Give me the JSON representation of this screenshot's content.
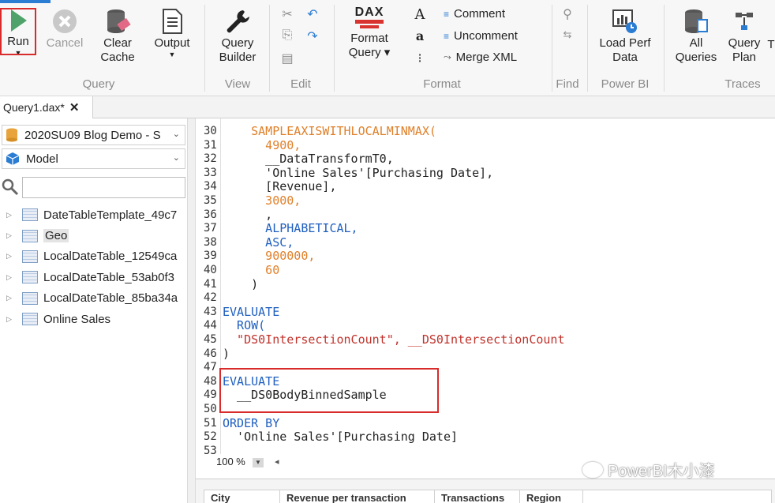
{
  "ribbon": {
    "groups": {
      "query": "Query",
      "view": "View",
      "edit": "Edit",
      "format": "Format",
      "find": "Find",
      "powerbi": "Power BI",
      "traces": "Traces"
    },
    "buttons": {
      "run": "Run",
      "cancel": "Cancel",
      "clear_cache": [
        "Clear",
        "Cache"
      ],
      "output": "Output",
      "query_builder": [
        "Query",
        "Builder"
      ],
      "format_query": [
        "Format",
        "Query ▾"
      ],
      "dax_logo": "DAX",
      "comment": "Comment",
      "uncomment": "Uncomment",
      "merge_xml": "Merge XML",
      "load_perf_data": [
        "Load Perf",
        "Data"
      ],
      "all_queries": [
        "All",
        "Queries"
      ],
      "query_plan": [
        "Query",
        "Plan"
      ],
      "overflow": "T"
    }
  },
  "tabs": {
    "active": "Query1.dax*"
  },
  "left_panel": {
    "connection": "2020SU09 Blog Demo - S",
    "model": "Model",
    "search_value": "",
    "tables": [
      {
        "label": "DateTableTemplate_49c7"
      },
      {
        "label": "Geo"
      },
      {
        "label": "LocalDateTable_12549ca"
      },
      {
        "label": "LocalDateTable_53ab0f3"
      },
      {
        "label": "LocalDateTable_85ba34a"
      },
      {
        "label": "Online Sales"
      }
    ]
  },
  "editor": {
    "lines": [
      {
        "n": "30",
        "t": "    SAMPLEAXISWITHLOCALMINMAX("
      },
      {
        "n": "31",
        "t": "      4900,"
      },
      {
        "n": "32",
        "t": "      __DataTransformT0,"
      },
      {
        "n": "33",
        "t": "      'Online Sales'[Purchasing Date],"
      },
      {
        "n": "34",
        "t": "      [Revenue],"
      },
      {
        "n": "35",
        "t": "      3000,"
      },
      {
        "n": "36",
        "t": "      ,"
      },
      {
        "n": "37",
        "t": "      ALPHABETICAL,"
      },
      {
        "n": "38",
        "t": "      ASC,"
      },
      {
        "n": "39",
        "t": "      900000,"
      },
      {
        "n": "40",
        "t": "      60"
      },
      {
        "n": "41",
        "t": "    )"
      },
      {
        "n": "42",
        "t": ""
      },
      {
        "n": "43",
        "t": "EVALUATE"
      },
      {
        "n": "44",
        "t": "  ROW("
      },
      {
        "n": "45",
        "t": "  \"DS0IntersectionCount\", __DS0IntersectionCount"
      },
      {
        "n": "46",
        "t": ")"
      },
      {
        "n": "47",
        "t": ""
      },
      {
        "n": "48",
        "t": "EVALUATE"
      },
      {
        "n": "49",
        "t": "  __DS0BodyBinnedSample"
      },
      {
        "n": "50",
        "t": ""
      },
      {
        "n": "51",
        "t": "ORDER BY"
      },
      {
        "n": "52",
        "t": "  'Online Sales'[Purchasing Date]"
      },
      {
        "n": "53",
        "t": ""
      }
    ],
    "zoom": "100 %"
  },
  "results": {
    "columns": [
      "City",
      "Revenue per transaction",
      "Transactions",
      "Region"
    ]
  },
  "watermark": "PowerBI木小漆",
  "colors": {
    "keyword": "#1f5fbf",
    "function": "#e0802a",
    "string": "#c0322b",
    "highlight": "#d82b2b"
  }
}
